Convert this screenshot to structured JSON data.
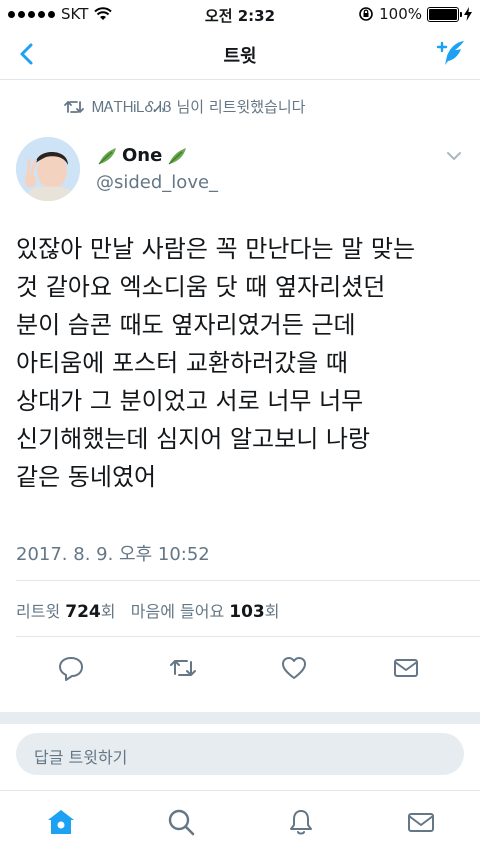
{
  "status_bar": {
    "carrier": "SKT",
    "time": "오전 2:32",
    "battery": "100%"
  },
  "nav": {
    "title": "트윗"
  },
  "retweet": {
    "text": "ᎷᎪᎢᎻᎥᏞᎴᏗᏰ 님이 리트윗했습니다"
  },
  "author": {
    "name": "One",
    "handle": "@sided_love_"
  },
  "tweet": {
    "text": "있잖아 만날 사람은 꼭 만난다는 말 맞는\n것 같아요 엑소디움 닷 때 옆자리셨던\n분이 슴콘 때도 옆자리였거든 근데\n아티움에 포스터 교환하러갔을 때\n상대가 그 분이었고 서로 너무 너무\n신기해했는데 심지어 알고보니 나랑\n같은 동네였어",
    "timestamp": "2017. 8. 9. 오후 10:52"
  },
  "stats": {
    "retweet_label": "리트윗",
    "retweet_count": "724",
    "retweet_unit": "회",
    "like_label": "마음에 들어요",
    "like_count": "103",
    "like_unit": "회"
  },
  "reply": {
    "placeholder": "답글 트윗하기"
  },
  "colors": {
    "accent": "#1da1f2",
    "muted": "#657786",
    "text": "#14171a"
  }
}
